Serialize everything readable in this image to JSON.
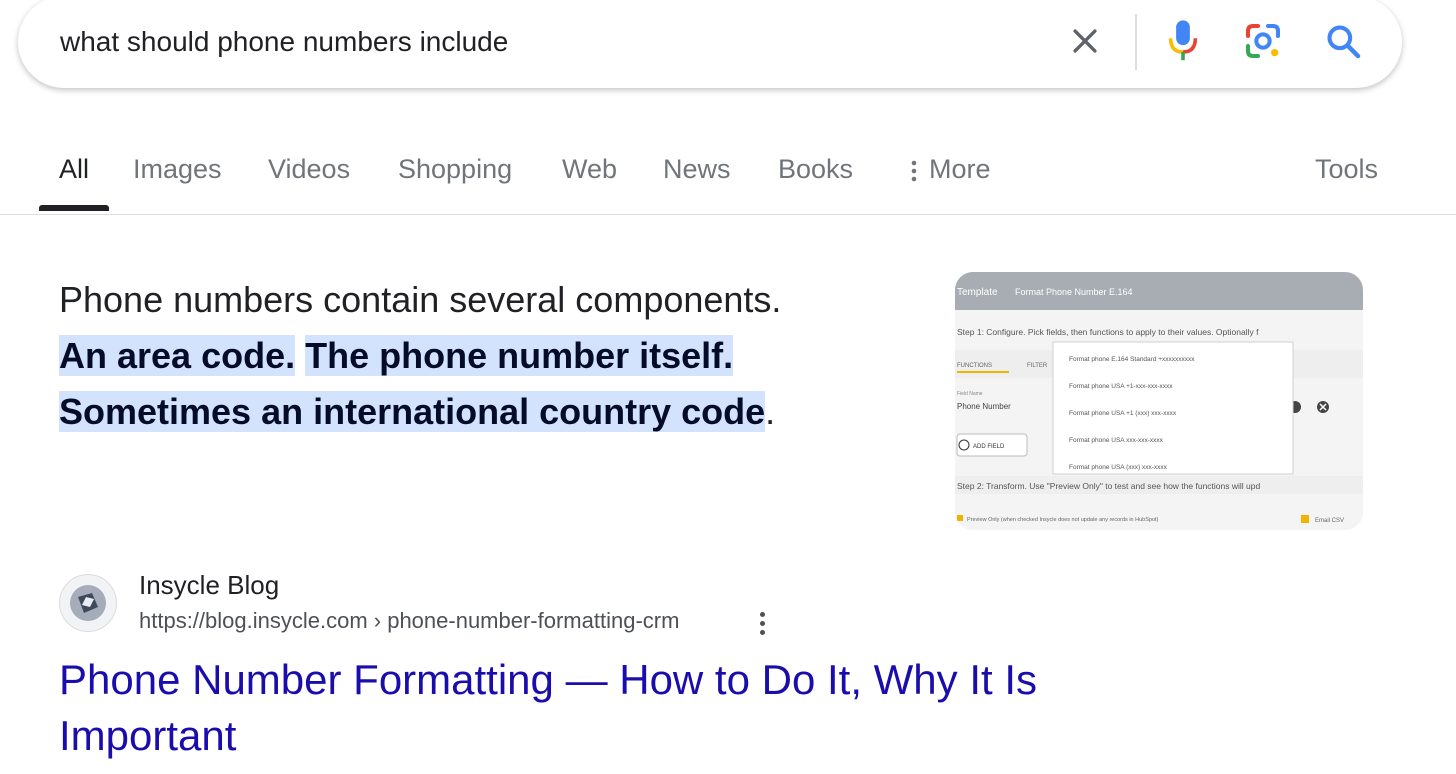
{
  "search": {
    "query": "what should phone numbers include",
    "icons": [
      "close-icon",
      "microphone-icon",
      "lens-icon",
      "search-icon"
    ]
  },
  "tabs": {
    "items": [
      {
        "label": "All",
        "active": true
      },
      {
        "label": "Images"
      },
      {
        "label": "Videos"
      },
      {
        "label": "Shopping"
      },
      {
        "label": "Web"
      },
      {
        "label": "News"
      },
      {
        "label": "Books"
      },
      {
        "label": "More",
        "icon": "vertical-dots-icon"
      }
    ],
    "tools": "Tools"
  },
  "answer": {
    "lead": "Phone numbers contain several components.",
    "highlight_1": "An area code.",
    "highlight_2": "The phone number itself.",
    "highlight_3": "Sometimes an international country cod",
    "highlight_3_tail": "e",
    "end": "."
  },
  "thumbnail": {
    "header_title": "Template",
    "header_sub": "Format Phone Number E.164",
    "step1": "Step 1: Configure. Pick fields, then functions to apply to their values. Optionally f",
    "tab_functions": "FUNCTIONS",
    "tab_filter": "FILTER",
    "field_label": "Field Name",
    "field_value": "Phone Number",
    "add_field": "ADD FIELD",
    "menu": [
      "Format phone E.164 Standard +xxxxxxxxxx",
      "Format phone USA +1-xxx-xxx-xxxx",
      "Format phone USA +1 (xxx) xxx-xxxx",
      "Format phone USA xxx-xxx-xxxx",
      "Format phone USA (xxx) xxx-xxxx"
    ],
    "step2": "Step 2: Transform. Use \"Preview Only\" to test and see how the functions will upd",
    "preview_note": "Preview Only (when checked Insycle does not update any records in HubSpot)",
    "email_csv": "Email CSV"
  },
  "result": {
    "site_name": "Insycle Blog",
    "url": "https://blog.insycle.com › phone-number-formatting-crm",
    "title_line1": "Phone Number Formatting — How to Do It, Why It Is",
    "title_line2": "Important"
  },
  "colors": {
    "link": "#1a0dab",
    "highlight": "#d3e3fd",
    "google_blue": "#4285f4",
    "google_red": "#ea4335",
    "google_yellow": "#fbbc04",
    "google_green": "#34a853"
  }
}
